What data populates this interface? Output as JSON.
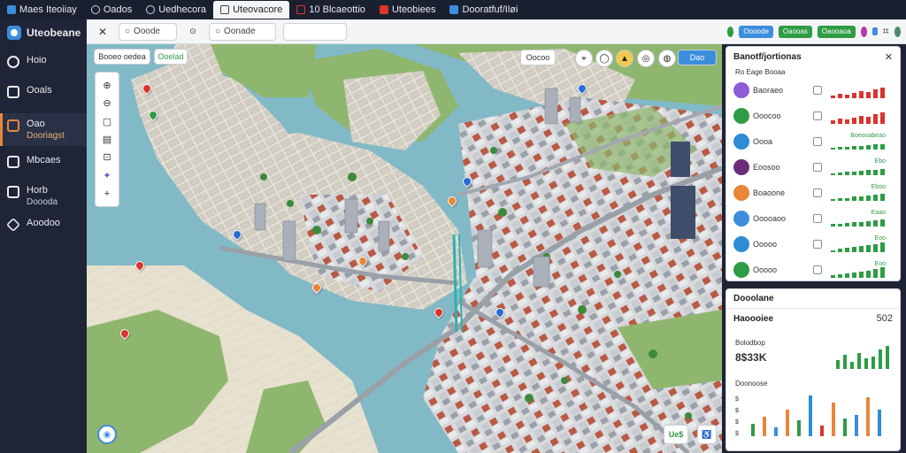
{
  "tabs": [
    {
      "label": "Maes Iteoiiay",
      "icon": "app-icon",
      "color": "#3c8dde",
      "active": false
    },
    {
      "label": "Oados",
      "icon": "circle-icon",
      "color": "",
      "active": false
    },
    {
      "label": "Uedhecora",
      "icon": "circle-icon",
      "color": "",
      "active": false
    },
    {
      "label": "Uteovacore",
      "icon": "document-icon",
      "color": "",
      "active": true
    },
    {
      "label": "10 Blcaeottio",
      "icon": "film-icon",
      "color": "#d8352e",
      "active": false
    },
    {
      "label": "Uteobiees",
      "icon": "chart-icon",
      "color": "#d8352e",
      "active": false
    },
    {
      "label": "Dooratfuf/Iløi",
      "icon": "monitor-icon",
      "color": "#3c8dde",
      "active": false
    }
  ],
  "sidebar": {
    "brand": "Uteobeane",
    "items": [
      {
        "label": "Hoio",
        "sub": "",
        "icon": "clock-icon",
        "active": false
      },
      {
        "label": "Ooals",
        "sub": "",
        "icon": "bookmark-icon",
        "active": false
      },
      {
        "label": "Oao",
        "sub": "Dooriagst",
        "icon": "folder-icon",
        "active": true
      },
      {
        "label": "Mbcaes",
        "sub": "",
        "icon": "home-icon",
        "active": false
      },
      {
        "label": "Horb",
        "sub": "Doooda",
        "icon": "layers-icon",
        "active": false
      },
      {
        "label": "Aoodoo",
        "sub": "",
        "icon": "diamond-icon",
        "active": false
      }
    ]
  },
  "toolbar": {
    "field1": "Ooode",
    "field2": "Oonade"
  },
  "map": {
    "chip1": "Booeo oedea",
    "chip2": "Ooelad",
    "chip_right_1": "Oocoo",
    "chip_right_2": "Dao",
    "badge_bottom": "Ue$",
    "pins": [
      {
        "color": "#d8352e"
      },
      {
        "color": "#2c6cd6"
      },
      {
        "color": "#e8863a"
      },
      {
        "color": "#2e9c45"
      },
      {
        "color": "#d8352e"
      },
      {
        "color": "#2c6cd6"
      },
      {
        "color": "#e8863a"
      },
      {
        "color": "#d8352e"
      },
      {
        "color": "#2c6cd6"
      },
      {
        "color": "#2c6cd6"
      },
      {
        "color": "#d8352e"
      },
      {
        "color": "#e8863a"
      }
    ]
  },
  "rightbar": {
    "pill1": "Oooode",
    "pill2": "Oaooas",
    "pill3": "Oaooaoa"
  },
  "panel1": {
    "title": "Banotf/jortionas",
    "subtitle": "Ro Eage Booaa",
    "rows": [
      {
        "name": "Baoraeo",
        "color": "#8c5bd8",
        "value": "",
        "trend": "red"
      },
      {
        "name": "Ooocoo",
        "color": "#2e9c45",
        "value": "",
        "trend": "red"
      },
      {
        "name": "Oooa",
        "color": "#2c8cd6",
        "value": "Boeooabeao",
        "trend": "green"
      },
      {
        "name": "Eoosoo",
        "color": "#6b2d7a",
        "value": "Ebo",
        "trend": "green"
      },
      {
        "name": "Boaoone",
        "color": "#e8863a",
        "value": "Eboo",
        "trend": "green"
      },
      {
        "name": "Ooooaoo",
        "color": "#3c8dde",
        "value": "Eaao",
        "trend": "green"
      },
      {
        "name": "Ooooo",
        "color": "#2c8cd6",
        "value": "Eoo",
        "trend": "green"
      },
      {
        "name": "Ooooo",
        "color": "#2e9c45",
        "value": "Eoo",
        "trend": "green"
      }
    ]
  },
  "panel2": {
    "title": "Dooolane",
    "subtitle": "Haoooiee",
    "close": "502",
    "label1": "Bolodbop",
    "big_value": "8$33K",
    "label2": "Doonoose",
    "bar_colors": [
      "#2e9c45",
      "#e8863a",
      "#3c8dde",
      "#e8863a",
      "#2e9c45",
      "#2c8cd6",
      "#d8352e",
      "#e8863a",
      "#2e9c45",
      "#3c8dde",
      "#e8863a",
      "#2c8cd6"
    ]
  }
}
